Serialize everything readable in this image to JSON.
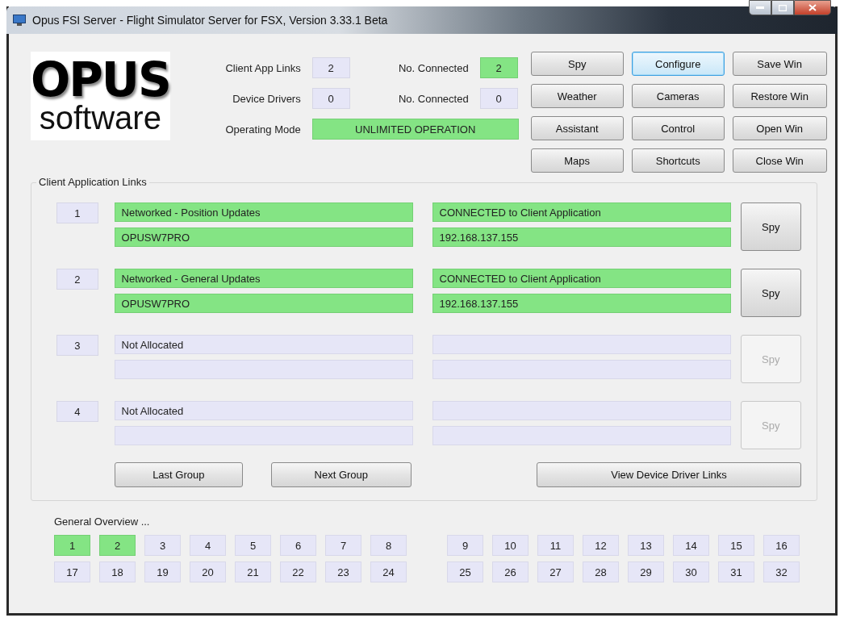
{
  "window": {
    "title": "Opus FSI Server - Flight Simulator Server for FSX, Version 3.33.1 Beta"
  },
  "logo": {
    "line_1": "OPUS",
    "line_2": "software"
  },
  "summary": [
    {
      "label": "Client App Links",
      "value": "2",
      "active": false
    },
    {
      "label": "No. Connected",
      "value": "2",
      "active": true
    },
    {
      "label": "Device Drivers",
      "value": "0",
      "active": false
    },
    {
      "label": "No. Connected",
      "value": "0",
      "active": false
    },
    {
      "label": "Operating Mode",
      "value": "UNLIMITED OPERATION",
      "active": true
    }
  ],
  "buttons": [
    {
      "label": "Spy",
      "focused": false
    },
    {
      "label": "Configure",
      "focused": true
    },
    {
      "label": "Save Win",
      "focused": false
    },
    {
      "label": "Weather",
      "focused": false
    },
    {
      "label": "Cameras",
      "focused": false
    },
    {
      "label": "Restore Win",
      "focused": false
    },
    {
      "label": "Assistant",
      "focused": false
    },
    {
      "label": "Control",
      "focused": false
    },
    {
      "label": "Open Win",
      "focused": false
    },
    {
      "label": "Maps",
      "focused": false
    },
    {
      "label": "Shortcuts",
      "focused": false
    },
    {
      "label": "Close Win",
      "focused": false
    }
  ],
  "client_links": {
    "title": "Client Application Links",
    "rows": [
      {
        "number": "1",
        "type": "Networked - Position Updates",
        "host": "OPUSW7PRO",
        "status": "CONNECTED to Client Application",
        "address": "192.168.137.155",
        "active": true,
        "spy": {
          "label": "Spy",
          "disabled": false
        }
      },
      {
        "number": "2",
        "type": "Networked - General Updates",
        "host": "OPUSW7PRO",
        "status": "CONNECTED to Client Application",
        "address": "192.168.137.155",
        "active": true,
        "spy": {
          "label": "Spy",
          "disabled": false
        }
      },
      {
        "number": "3",
        "type": "Not Allocated",
        "active": false,
        "spy": {
          "label": "Spy",
          "disabled": true
        }
      },
      {
        "number": "4",
        "type": "Not Allocated",
        "active": false,
        "spy": {
          "label": "Spy",
          "disabled": true
        }
      }
    ],
    "nav_buttons": [
      "Last Group",
      "Next Group"
    ],
    "view_button": "View Device Driver Links"
  },
  "overview": {
    "title": "General Overview ...",
    "slots": [
      {
        "label": "1",
        "active": true
      },
      {
        "label": "2",
        "active": true
      },
      {
        "label": "3",
        "active": false
      },
      {
        "label": "4",
        "active": false
      },
      {
        "label": "5",
        "active": false
      },
      {
        "label": "6",
        "active": false
      },
      {
        "label": "7",
        "active": false
      },
      {
        "label": "8",
        "active": false
      },
      {
        "label": "9",
        "active": false
      },
      {
        "label": "10",
        "active": false
      },
      {
        "label": "11",
        "active": false
      },
      {
        "label": "12",
        "active": false
      },
      {
        "label": "13",
        "active": false
      },
      {
        "label": "14",
        "active": false
      },
      {
        "label": "15",
        "active": false
      },
      {
        "label": "16",
        "active": false
      },
      {
        "label": "17",
        "active": false
      },
      {
        "label": "18",
        "active": false
      },
      {
        "label": "19",
        "active": false
      },
      {
        "label": "20",
        "active": false
      },
      {
        "label": "21",
        "active": false
      },
      {
        "label": "22",
        "active": false
      },
      {
        "label": "23",
        "active": false
      },
      {
        "label": "24",
        "active": false
      },
      {
        "label": "25",
        "active": false
      },
      {
        "label": "26",
        "active": false
      },
      {
        "label": "27",
        "active": false
      },
      {
        "label": "28",
        "active": false
      },
      {
        "label": "29",
        "active": false
      },
      {
        "label": "30",
        "active": false
      },
      {
        "label": "31",
        "active": false
      },
      {
        "label": "32",
        "active": false
      }
    ]
  }
}
